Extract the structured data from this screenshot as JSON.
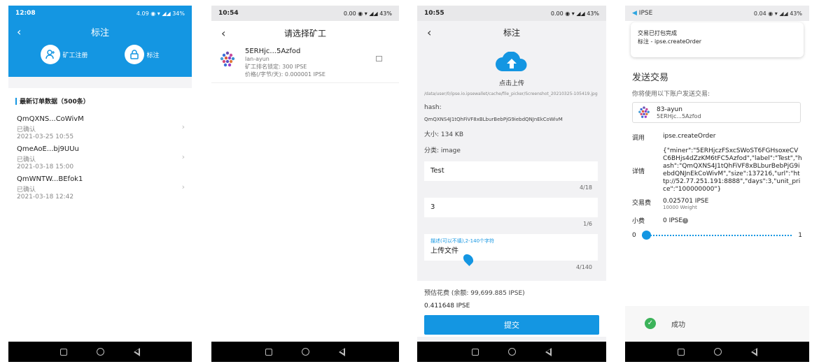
{
  "screens": {
    "order_list": {
      "status_time": "12:08",
      "status_right": "4.09 ◉ ▾ ◢◢ 34%",
      "title": "标注",
      "action_register": "矿工注册",
      "action_label": "标注",
      "section_title": "最新订单数据（500条）",
      "orders": [
        {
          "id": "QmQXNS...CoWivM",
          "status": "已确认",
          "date": "2021-03-25 10:55"
        },
        {
          "id": "QmeAoE...bj9UUu",
          "status": "已确认",
          "date": "2021-03-18 15:00"
        },
        {
          "id": "QmWNTW...BEfok1",
          "status": "已确认",
          "date": "2021-03-18 12:42"
        }
      ]
    },
    "select_miner": {
      "status_time": "10:54",
      "status_right": "0.00 ◉ ▾ ◢◢ 43%",
      "title": "请选择矿工",
      "miner_name": "5ERHjc...5Azfod",
      "miner_sub": "lan-ayun",
      "miner_locked": "矿工排名锁定: 300 IPSE",
      "miner_price": "价格(/字节/天): 0.000001 IPSE"
    },
    "label_form": {
      "status_time": "10:55",
      "status_right": "0.00 ◉ ▾ ◢◢ 43%",
      "title": "标注",
      "upload_label": "点击上传",
      "file_path": "/data/user/0/ipse.io.ipsewallet/cache/file_picker/Screenshot_20210325-105419.jpg",
      "hash_label": "hash:",
      "hash_value": "QmQXNS4J1tQhFiVF8xBLburBebPjG9iebdQNJnEkCoWivM",
      "size": "大小: 134 KB",
      "category": "分类: image",
      "name_value": "Test",
      "name_counter": "4/18",
      "days_value": "3",
      "days_counter": "1/6",
      "desc_hint": "描述(可以不填),2-140个字符",
      "desc_value": "上传文件",
      "desc_counter": "4/140",
      "fee_estimate": "预估花费 (余额: 99,699.885 IPSE)",
      "fee_value": "0.411648 IPSE",
      "submit": "提交"
    },
    "send_tx": {
      "status_app": "IPSE",
      "status_right": "0.04 ◉ ▾ ◢◢ 43%",
      "toast_line1": "交易已打包完成",
      "toast_line2": "标注 - ipse.createOrder",
      "title": "发送交易",
      "subtitle": "你将使用以下账户发送交易:",
      "account_name": "83-ayun",
      "account_addr": "5ERHjc...5Azfod",
      "call_label": "调用",
      "call_value": "ipse.createOrder",
      "details_label": "详情",
      "details_value": "{\"miner\":\"5ERHjczFSxcSWoST6FGHsoxeCVC6BHjs4dZzKM6tFC5Azfod\",\"label\":\"Test\",\"hash\":\"QmQXNS4J1tQhFiVF8xBLburBebPjG9iebdQNJnEkCoWivM\",\"size\":137216,\"url\":\"http://52.77.251.191:8888\",\"days\":3,\"unit_price\":\"100000000\"}",
      "fee_label": "交易费",
      "fee_value": "0.025701 IPSE",
      "fee_weight": "10000 Weight",
      "tip_label": "小费",
      "tip_value": "0 IPSE",
      "slider_min": "0",
      "slider_max": "1",
      "slider_level": 0,
      "success_text": "成功"
    }
  },
  "colors": {
    "accent": "#1496e2",
    "success": "#3cb35a"
  }
}
